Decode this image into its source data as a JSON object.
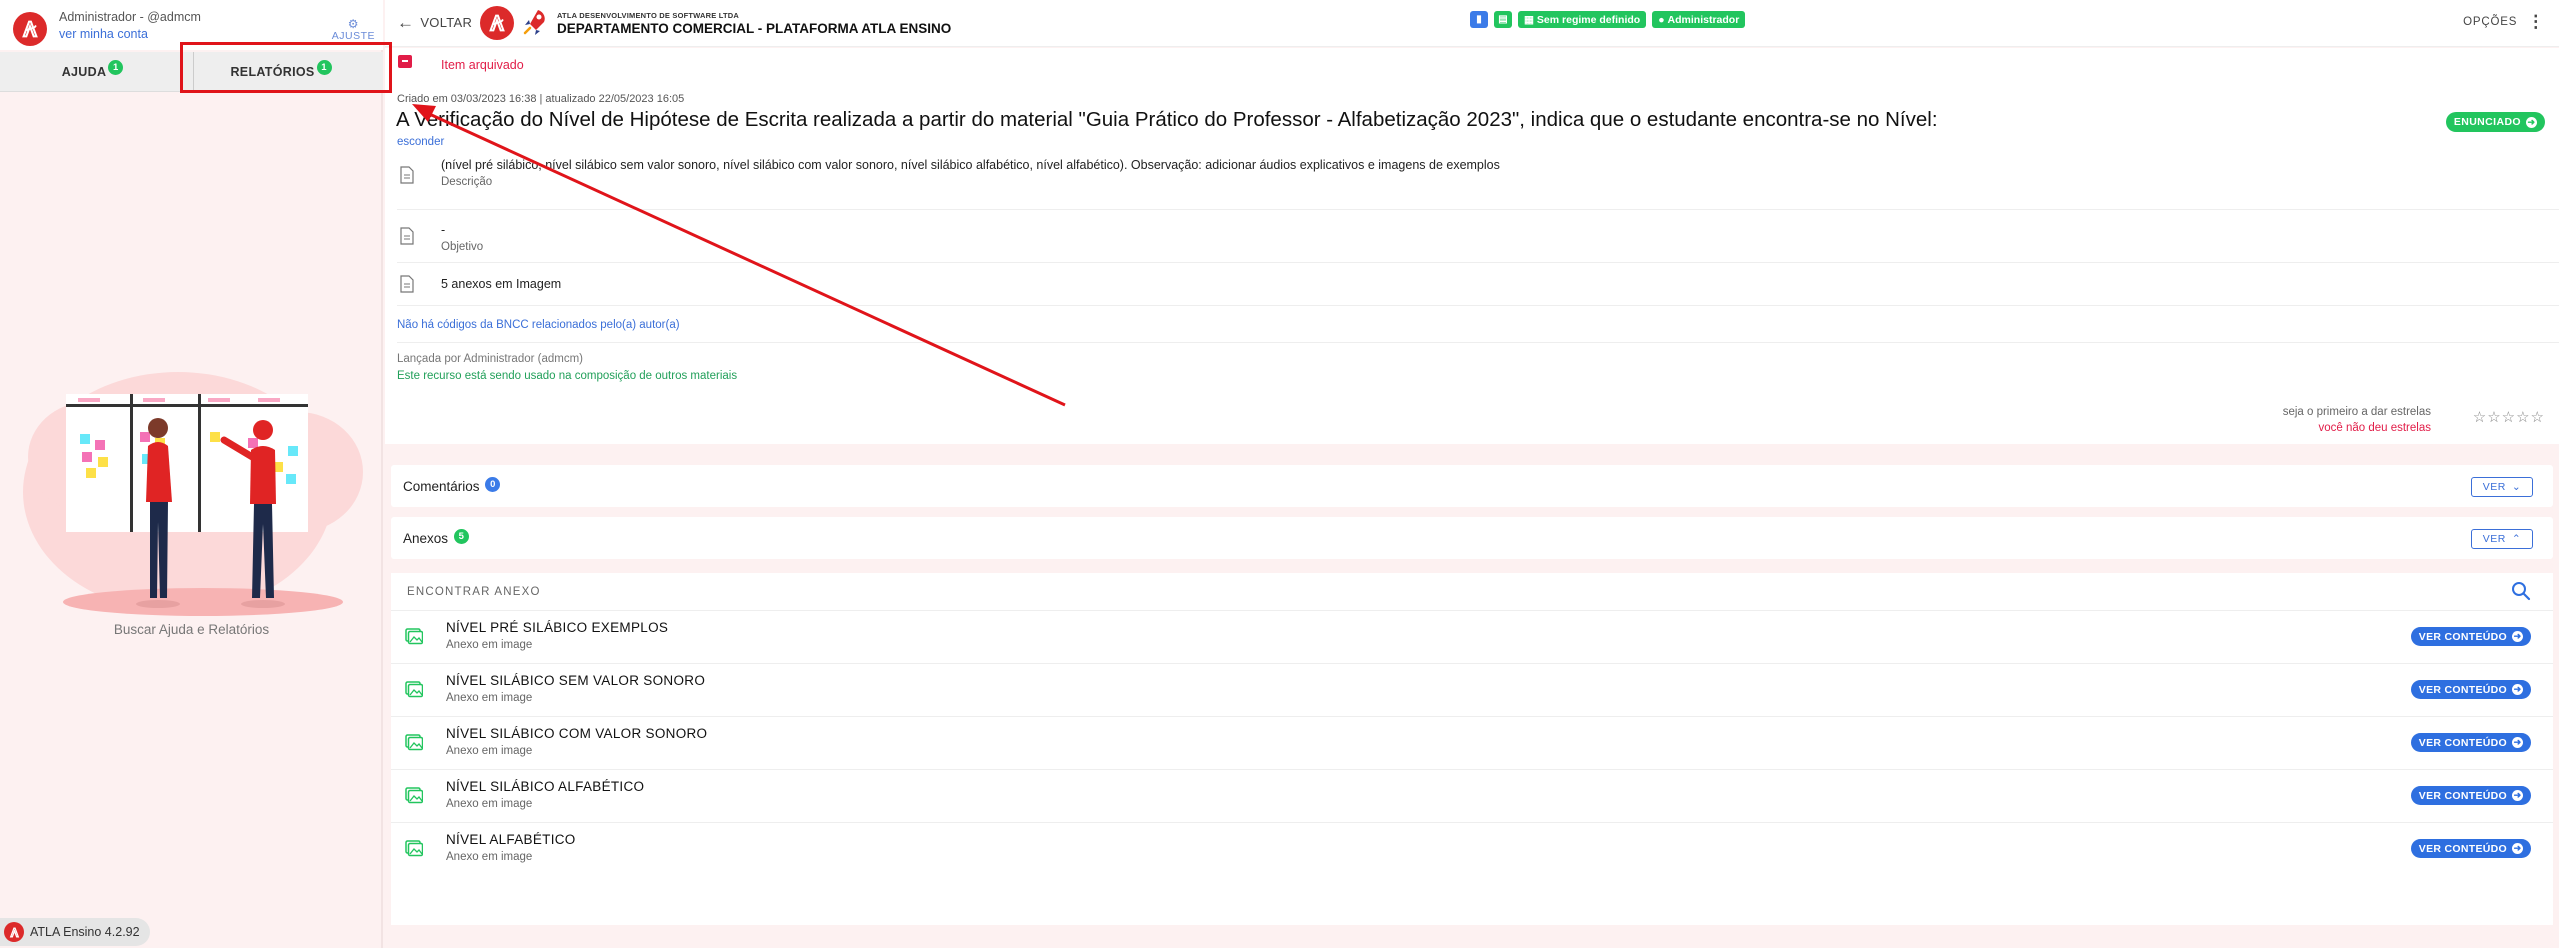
{
  "sidebar": {
    "username": "Administrador - @admcm",
    "account_link": "ver minha conta",
    "adjust_label": "AJUSTE",
    "tabs": [
      {
        "label": "AJUDA",
        "badge": "1"
      },
      {
        "label": "RELATÓRIOS",
        "badge": "1"
      }
    ],
    "illustration_caption": "Buscar Ajuda e Relatórios",
    "version": "ATLA Ensino 4.2.92"
  },
  "header": {
    "back_label": "VOLTAR",
    "company_small": "ATLA DESENVOLVIMENTO DE SOFTWARE LTDA",
    "company_big": "DEPARTAMENTO COMERCIAL - PLATAFORMA ATLA ENSINO",
    "chips": [
      "Sem regime definido",
      "Administrador"
    ],
    "options_label": "OPÇÕES"
  },
  "resource": {
    "archived_label": "Item arquivado",
    "created_info": "Criado em 03/03/2023 16:38 | atualizado 22/05/2023 16:05",
    "title": "A Verificação do Nível de Hipótese de Escrita realizada a partir do material \"Guia Prático do Professor - Alfabetização 2023\", indica que o estudante encontra-se no Nível:",
    "enunciado_label": "ENUNCIADO",
    "hide_link": "esconder",
    "description_value": "(nível pré silábico, nível silábico sem valor sonoro, nível silábico com valor sonoro, nível silábico alfabético, nível alfabético). Observação: adicionar áudios explicativos e imagens de exemplos",
    "description_label": "Descrição",
    "objective_value": "-",
    "objective_label": "Objetivo",
    "attachments_summary": "5 anexos em Imagem",
    "bncc_note": "Não há códigos da BNCC relacionados pelo(a) autor(a)",
    "launched_by": "Lançada por Administrador (admcm)",
    "usage_note": "Este recurso está sendo usado na composição de outros materiais",
    "stars_prompt": "seja o primeiro a dar estrelas",
    "stars_none": "você não deu estrelas",
    "stars_glyphs": "☆☆☆☆☆",
    "rating": 0
  },
  "comments": {
    "title": "Comentários",
    "count": "0",
    "ver_label": "VER"
  },
  "annexes": {
    "title": "Anexos",
    "count": "5",
    "ver_label": "VER",
    "find_label": "ENCONTRAR ANEXO",
    "button_label": "VER CONTEÚDO",
    "items": [
      {
        "name": "NÍVEL PRÉ SILÁBICO EXEMPLOS",
        "type": "Anexo em image"
      },
      {
        "name": "NÍVEL SILÁBICO SEM VALOR SONORO",
        "type": "Anexo em image"
      },
      {
        "name": "NÍVEL SILÁBICO COM VALOR SONORO",
        "type": "Anexo em image"
      },
      {
        "name": "NÍVEL SILÁBICO ALFABÉTICO",
        "type": "Anexo em image"
      },
      {
        "name": "NÍVEL ALFABÉTICO",
        "type": "Anexo em image"
      }
    ]
  },
  "colors": {
    "brand_red": "#dc2a2a",
    "accent_blue": "#2e6fe0",
    "success_green": "#22c55e",
    "danger_pink": "#e11d48",
    "annotation_red": "#e0141a"
  }
}
